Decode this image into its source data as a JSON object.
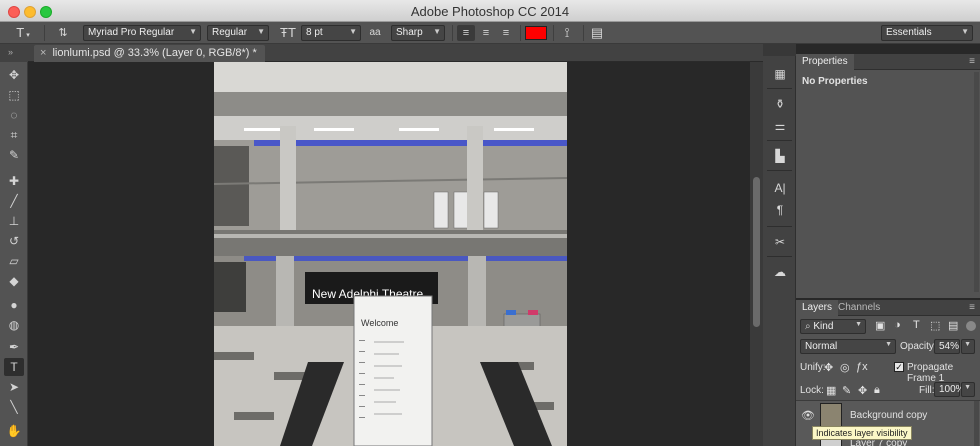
{
  "window": {
    "title": "Adobe Photoshop CC 2014"
  },
  "options": {
    "font_family": "Myriad Pro Regular",
    "font_style": "Regular",
    "font_size": "8 pt",
    "aa_label": "aa",
    "antialias": "Sharp",
    "text_color": "#ff0000",
    "workspace": "Essentials"
  },
  "document": {
    "tab_title": "lionlumi.psd @ 33.3% (Layer 0, RGB/8*) *",
    "close_glyph": "×"
  },
  "photo": {
    "sign_text": "New Adelphi Theatre",
    "welcome_text": "Welcome"
  },
  "properties_panel": {
    "tab": "Properties",
    "content": "No Properties"
  },
  "layers_panel": {
    "tabs": [
      "Layers",
      "Channels"
    ],
    "filter_kind": "Kind",
    "blend_mode": "Normal",
    "opacity_label": "Opacity:",
    "opacity_value": "54%",
    "unify_label": "Unify:",
    "propagate_label": "Propagate Frame 1",
    "lock_label": "Lock:",
    "fill_label": "Fill:",
    "fill_value": "100%",
    "layers": [
      {
        "name": "Background copy"
      },
      {
        "name": "Layer 7 copy"
      }
    ],
    "tooltip": "Indicates layer visibility"
  },
  "colors": {
    "accent_red": "#ff0000",
    "panel_bg": "#535353",
    "canvas_bg": "#282828"
  },
  "icons": {
    "tools": [
      "move-icon",
      "marquee-icon",
      "lasso-icon",
      "crop-icon",
      "eyedropper-icon",
      "healing-brush-icon",
      "brush-icon",
      "clone-stamp-icon",
      "history-brush-icon",
      "eraser-icon",
      "paint-bucket-icon",
      "blur-icon",
      "dodge-icon",
      "pen-icon",
      "type-icon",
      "path-selection-icon",
      "line-icon",
      "hand-icon"
    ]
  }
}
